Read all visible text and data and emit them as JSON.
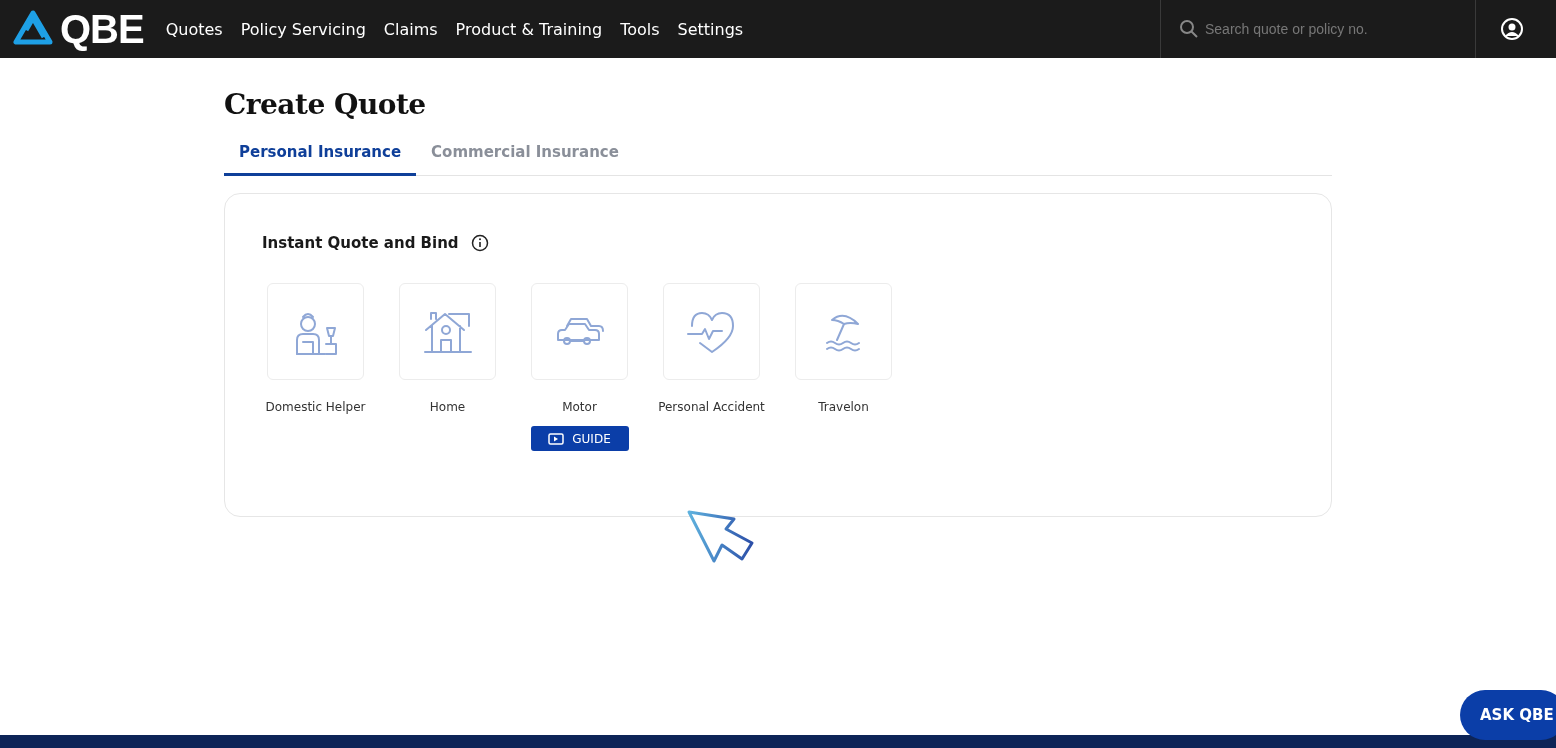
{
  "nav": {
    "logo": "QBE",
    "items": [
      {
        "label": "Quotes"
      },
      {
        "label": "Policy Servicing"
      },
      {
        "label": "Claims"
      },
      {
        "label": "Product & Training"
      },
      {
        "label": "Tools"
      },
      {
        "label": "Settings"
      }
    ],
    "search": {
      "placeholder": "Search quote or policy no."
    }
  },
  "page": {
    "title": "Create Quote",
    "tabs": [
      {
        "label": "Personal Insurance",
        "selected": true
      },
      {
        "label": "Commercial Insurance",
        "selected": false
      }
    ]
  },
  "section": {
    "title": "Instant Quote and Bind",
    "products": [
      {
        "kind": "helper",
        "label": "Domestic Helper"
      },
      {
        "kind": "home",
        "label": "Home"
      },
      {
        "kind": "motor",
        "label": "Motor",
        "guide": "GUIDE"
      },
      {
        "kind": "accident",
        "label": "Personal Accident"
      },
      {
        "kind": "travel",
        "label": "Travelon"
      }
    ]
  },
  "chat_button": "ASK QBE"
}
